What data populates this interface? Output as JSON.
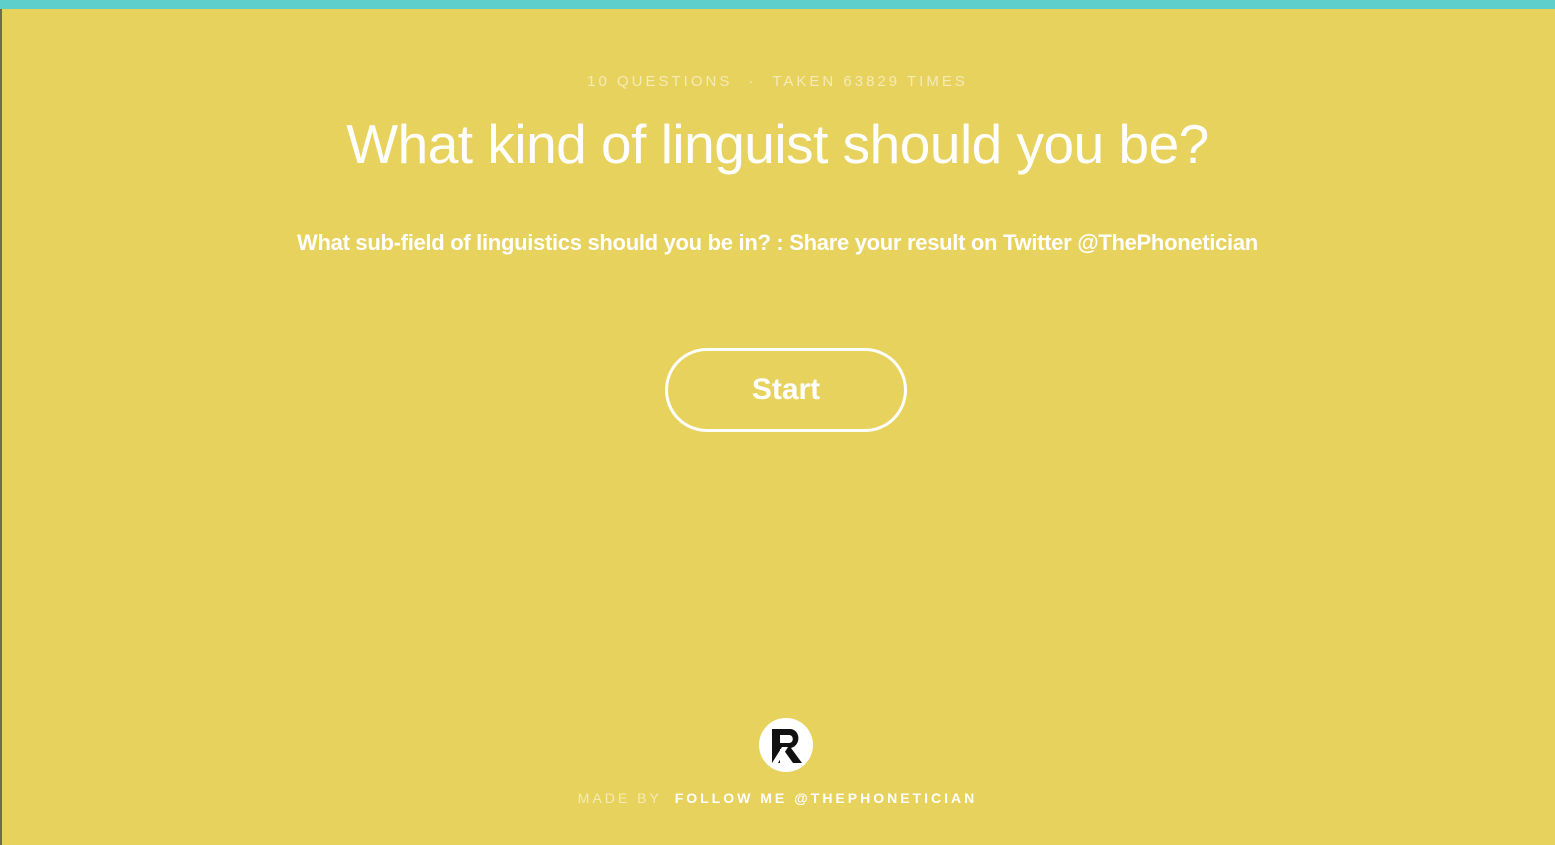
{
  "colors": {
    "background": "#e8d25e",
    "top_bar": "#5ecfcb",
    "text": "#ffffff"
  },
  "quiz": {
    "question_count": "10 Questions",
    "separator": "·",
    "taken_count": "Taken 63829 Times",
    "title": "What kind of linguist should you be?",
    "description": "What sub-field of linguistics should you be in? : Share your result on Twitter @ThePhonetician",
    "start_label": "Start"
  },
  "footer": {
    "logo_icon": "r-logo-icon",
    "made_by_label": "Made by",
    "author_link": "Follow me @ThePhonetician"
  }
}
